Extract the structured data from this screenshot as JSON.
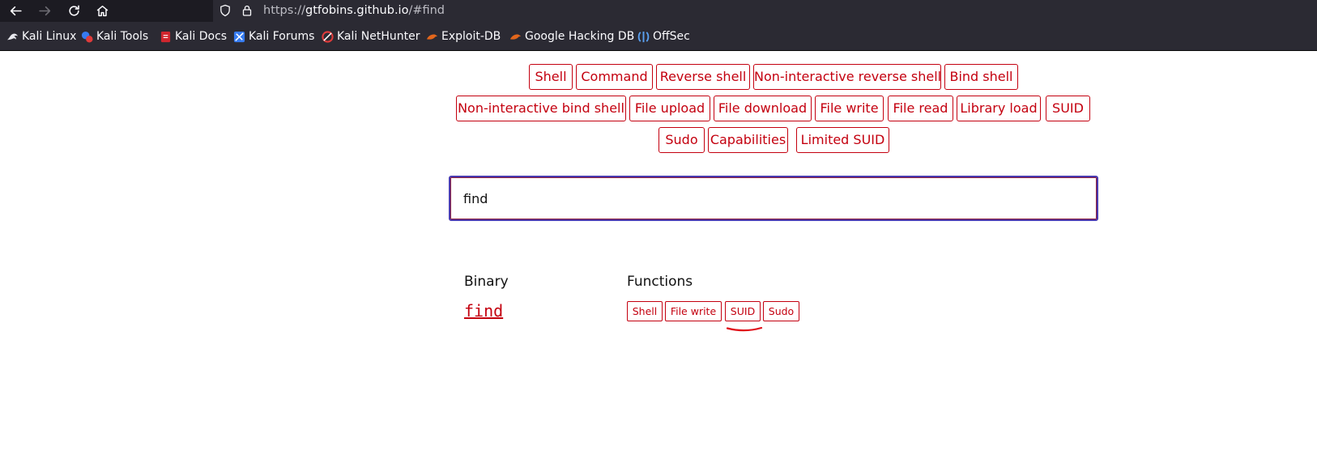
{
  "browser": {
    "url_prefix": "https://",
    "url_host": "gtfobins.github.io",
    "url_path": "/#find",
    "nav_icons": [
      "back-arrow-icon",
      "forward-arrow-icon",
      "reload-icon",
      "home-icon"
    ],
    "bookmarks": [
      {
        "label": "Kali Linux",
        "icon": "kali-dragon-icon"
      },
      {
        "label": "Kali Tools",
        "icon": "kali-tools-icon"
      },
      {
        "label": "Kali Docs",
        "icon": "kali-docs-icon"
      },
      {
        "label": "Kali Forums",
        "icon": "kali-forums-icon"
      },
      {
        "label": "Kali NetHunter",
        "icon": "nethunter-icon"
      },
      {
        "label": "Exploit-DB",
        "icon": "exploit-db-icon"
      },
      {
        "label": "Google Hacking DB",
        "icon": "ghdb-icon"
      },
      {
        "label": "OffSec",
        "icon": "offsec-icon"
      }
    ]
  },
  "filters": {
    "row1": [
      "Shell",
      "Command",
      "Reverse shell",
      "Non-interactive reverse shell",
      "Bind shell"
    ],
    "row2": [
      "Non-interactive bind shell",
      "File upload",
      "File download",
      "File write",
      "File read",
      "Library load",
      "SUID"
    ],
    "row3": [
      "Sudo",
      "Capabilities",
      "Limited SUID"
    ]
  },
  "search": {
    "value": "find"
  },
  "results": {
    "binary_header": "Binary",
    "functions_header": "Functions",
    "rows": [
      {
        "binary": "find",
        "functions": [
          "Shell",
          "File write",
          "SUID",
          "Sudo"
        ]
      }
    ]
  },
  "colors": {
    "accent": "#c4000f",
    "annotation": "#e0101a",
    "search_border": "#4a3ab0"
  }
}
